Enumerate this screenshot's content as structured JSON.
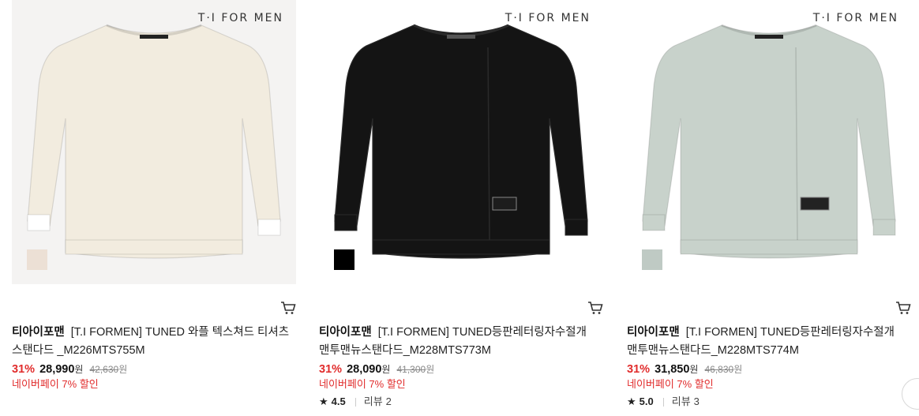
{
  "products": [
    {
      "brand_mark": "T·I FOR MEN",
      "bg_color": "#f4f3f2",
      "shirt_color": "#f2ecdf",
      "swatch_color": "#ece0d5",
      "shop": "티아이포맨",
      "name": "[T.I FORMEN] TUNED 와플 텍스쳐드 티셔츠 스탠다드 _M226MTS755M",
      "discount": "31%",
      "price": "28,990",
      "currency": "원",
      "original_price": "42,630",
      "promo": "네이버페이 7% 할인",
      "rating": null,
      "review_label": null,
      "review_count": null
    },
    {
      "brand_mark": "T·I FOR MEN",
      "bg_color": "#ffffff",
      "shirt_color": "#141414",
      "swatch_color": "#000000",
      "shop": "티아이포맨",
      "name": "[T.I FORMEN] TUNED등판레터링자수절개맨투맨뉴스탠다드_M228MTS773M",
      "discount": "31%",
      "price": "28,090",
      "currency": "원",
      "original_price": "41,300",
      "promo": "네이버페이 7% 할인",
      "rating": "4.5",
      "review_label": "리뷰",
      "review_count": "2"
    },
    {
      "brand_mark": "T·I FOR MEN",
      "bg_color": "#ffffff",
      "shirt_color": "#c8d2cb",
      "swatch_color": "#bfcac4",
      "shop": "티아이포맨",
      "name": "[T.I FORMEN] TUNED등판레터링자수절개맨투맨뉴스탠다드_M228MTS774M",
      "discount": "31%",
      "price": "31,850",
      "currency": "원",
      "original_price": "46,830",
      "promo": "네이버페이 7% 할인",
      "rating": "5.0",
      "review_label": "리뷰",
      "review_count": "3"
    }
  ],
  "icons": {
    "cart": "cart-icon",
    "star": "star-icon"
  },
  "colors": {
    "discount": "#e12c2c",
    "promo": "#e12c2c"
  }
}
